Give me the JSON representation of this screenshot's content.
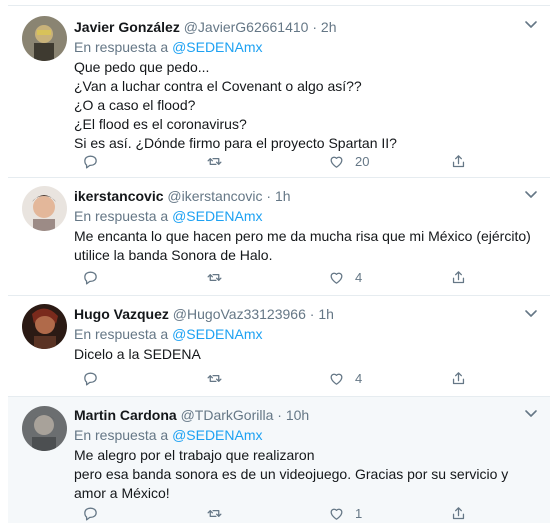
{
  "colors": {
    "accent": "#1da1f2",
    "muted": "#657786",
    "text": "#14171a",
    "divider": "#e6ecf0"
  },
  "tweets": [
    {
      "name": "Javier González",
      "handle": "@JavierG62661410",
      "dot": "·",
      "time": "2h",
      "reply_prefix": "En respuesta a",
      "reply_to": "@SEDENAmx",
      "text": "Que pedo que pedo...\n¿Van a luchar contra el Covenant o algo así??\n¿O a caso el flood?\n¿El flood es el coronavirus?\nSi es así. ¿Dónde firmo para el proyecto Spartan II?",
      "reply_count": "",
      "retweet_count": "",
      "like_count": "20"
    },
    {
      "name": "ikerstancovic",
      "handle": "@ikerstancovic",
      "dot": "·",
      "time": "1h",
      "reply_prefix": "En respuesta a",
      "reply_to": "@SEDENAmx",
      "text": "Me encanta lo que hacen pero me da mucha risa que mi México (ejército) utilice la banda Sonora de Halo.",
      "reply_count": "",
      "retweet_count": "",
      "like_count": "4"
    },
    {
      "name": "Hugo Vazquez",
      "handle": "@HugoVaz33123966",
      "dot": "·",
      "time": "1h",
      "reply_prefix": "En respuesta a",
      "reply_to": "@SEDENAmx",
      "text": "Dicelo a la SEDENA",
      "reply_count": "",
      "retweet_count": "",
      "like_count": "4"
    },
    {
      "name": "Martin Cardona",
      "handle": "@TDarkGorilla",
      "dot": "·",
      "time": "10h",
      "reply_prefix": "En respuesta a",
      "reply_to": "@SEDENAmx",
      "text": "Me alegro por el trabajo que realizaron\n pero esa banda sonora es de un videojuego. Gracias por su servicio y amor a México!",
      "reply_count": "",
      "retweet_count": "",
      "like_count": "1"
    }
  ]
}
